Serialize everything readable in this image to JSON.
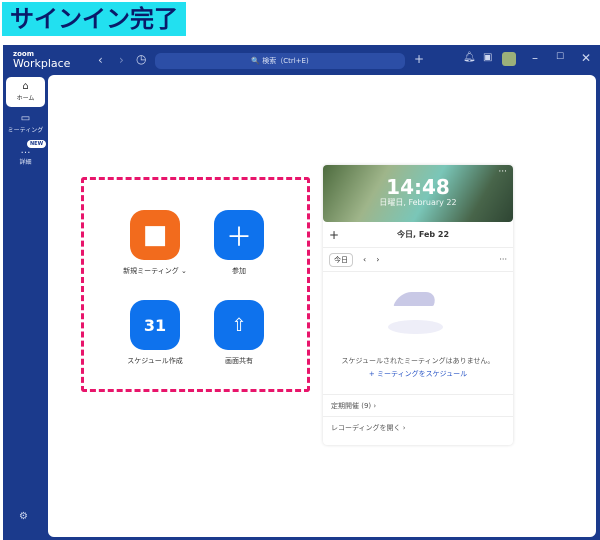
{
  "caption": "サインイン完了",
  "app": {
    "brand_small": "zoom",
    "brand": "Workplace"
  },
  "titlebar": {
    "search_placeholder": "🔍 検索（Ctrl+E)"
  },
  "sidebar": {
    "items": [
      {
        "label": "ホーム"
      },
      {
        "label": "ミーティング"
      },
      {
        "label": "詳細"
      }
    ],
    "new_badge": "NEW"
  },
  "actions": [
    {
      "label": "新規ミーティング ⌄",
      "color": "#f26b1d"
    },
    {
      "label": "参加",
      "color": "#0e72ed"
    },
    {
      "label": "スケジュール作成",
      "color": "#0e72ed",
      "day": "31"
    },
    {
      "label": "画面共有",
      "color": "#0e72ed"
    }
  ],
  "calendar": {
    "time": "14:48",
    "date": "日曜日, February 22",
    "today_label": "今日, Feb 22",
    "today_button": "今日",
    "empty_text": "スケジュールされたミーティングはありません。",
    "schedule_link": "ミーティングをスケジュール",
    "recurring": "定期開催 (9)",
    "recordings": "レコーディングを開く"
  }
}
